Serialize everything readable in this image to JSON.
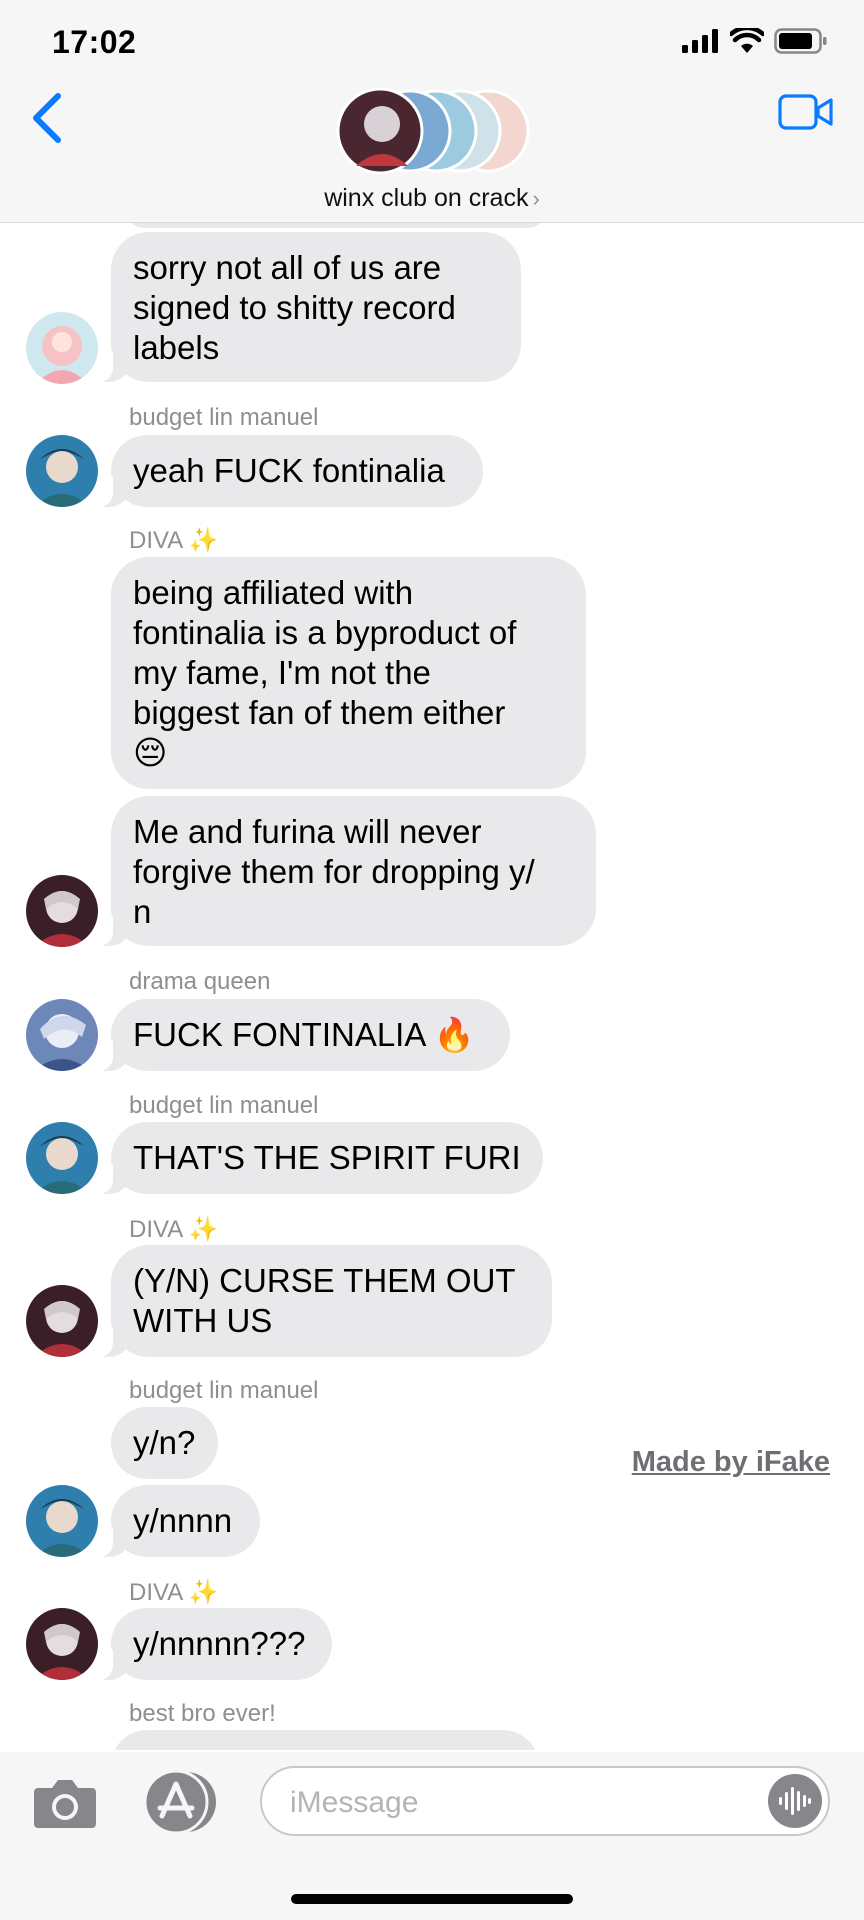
{
  "status_bar": {
    "time": "17:02"
  },
  "header": {
    "group_name": "winx club on crack",
    "chevron": "›"
  },
  "messages": [
    {
      "sender": "",
      "text": "sorry not all of us are\nsigned to shitty record\nlabels"
    },
    {
      "sender": "budget lin manuel",
      "text": "yeah FUCK fontinalia"
    },
    {
      "sender": "DIVA ✨",
      "text": "being affiliated with\nfontinalia is a byproduct of\nmy fame, I'm not the\nbiggest fan of them either\n😔"
    },
    {
      "sender": "",
      "text": "Me and furina will never\nforgive them for dropping y/\nn"
    },
    {
      "sender": "drama queen",
      "text": "FUCK FONTINALIA 🔥"
    },
    {
      "sender": "budget lin manuel",
      "text": "THAT'S THE SPIRIT FURI"
    },
    {
      "sender": "DIVA ✨",
      "text": "(Y/N) CURSE THEM OUT\nWITH US"
    },
    {
      "sender": "budget lin manuel",
      "text": "y/n?"
    },
    {
      "sender": "",
      "text": "y/nnnn"
    },
    {
      "sender": "DIVA ✨",
      "text": "y/nnnnn???"
    },
    {
      "sender": "best bro ever!",
      "text": ""
    }
  ],
  "watermark": "Made by iFake",
  "input": {
    "placeholder": "iMessage",
    "value": ""
  },
  "icons": {
    "back": "chevron-left-icon",
    "video": "video-camera-icon",
    "camera": "camera-icon",
    "apps": "app-store-icon",
    "audio": "audio-waveform-icon"
  },
  "colors": {
    "accent": "#0a7aff",
    "bubble": "#e9e9eb",
    "meta_text": "#8e8e93"
  }
}
